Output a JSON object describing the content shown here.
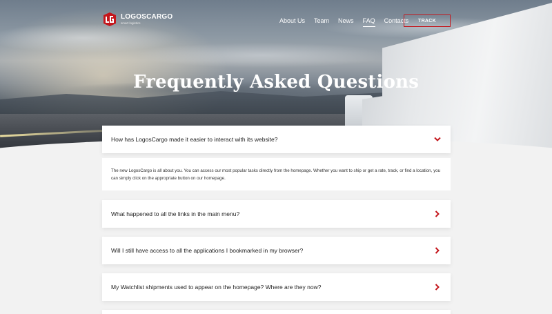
{
  "brand": {
    "name": "LOGOSCARGO",
    "tagline": "smart logistics",
    "accent_color": "#c4161c"
  },
  "nav": {
    "items": [
      {
        "label": "About Us",
        "active": false
      },
      {
        "label": "Team",
        "active": false
      },
      {
        "label": "News",
        "active": false
      },
      {
        "label": "FAQ",
        "active": true
      },
      {
        "label": "Contacts",
        "active": false
      }
    ],
    "track_label": "TRACK"
  },
  "hero": {
    "title": "Frequently Asked Questions"
  },
  "faq": {
    "items": [
      {
        "question": "How has LogosCargo made it easier to interact with its website?",
        "expanded": true,
        "icon": "chevron-down-icon"
      },
      {
        "question": "What happened to all the links in the main menu?",
        "expanded": false,
        "icon": "chevron-right-icon"
      },
      {
        "question": "Will I still have access to all the applications I bookmarked in my browser?",
        "expanded": false,
        "icon": "chevron-right-icon"
      },
      {
        "question": "My Watchlist shipments used to appear on the homepage? Where are they now?",
        "expanded": false,
        "icon": "chevron-right-icon"
      }
    ],
    "answer": "The new LogosCargo is all about you. You can access our most popular tasks directly from the homepage. Whether you want to ship or get a rate, track, or find a location, you can simply click on the appropriate button on our homepage."
  }
}
